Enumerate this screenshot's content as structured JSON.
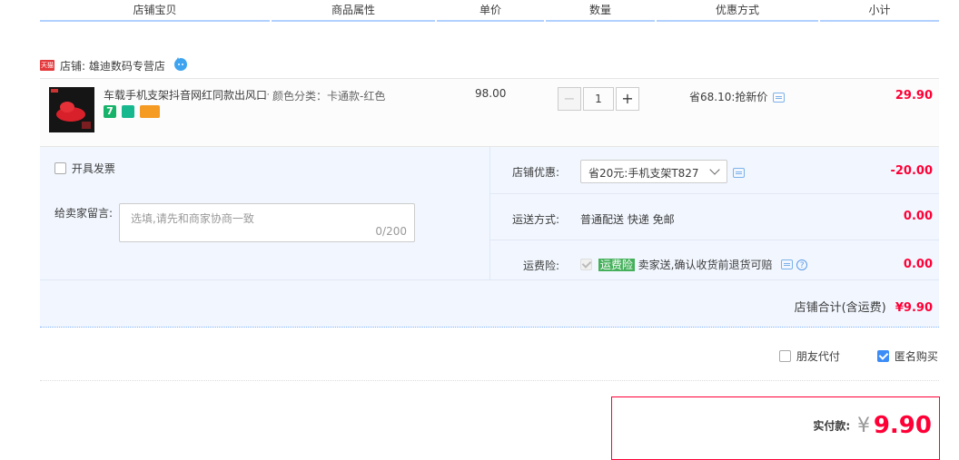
{
  "header": {
    "columns": [
      "店铺宝贝",
      "商品属性",
      "单价",
      "数量",
      "优惠方式",
      "小计"
    ]
  },
  "store": {
    "badge": "天猫",
    "label": "店铺: 雄迪数码专营店"
  },
  "item": {
    "title": "车载手机支架抖音网红同款出风口卡扣式车上支撑架",
    "tag_seven": "7",
    "attribute": "颜色分类：卡通款-红色",
    "unit_price": "98.00",
    "quantity": "1",
    "minus": "−",
    "plus": "+",
    "discount": "省68.10:抢新价",
    "subtotal": "29.90"
  },
  "invoice": {
    "label": "开具发票"
  },
  "message": {
    "label": "给卖家留言:",
    "placeholder": "选填,请先和商家协商一致",
    "counter": "0/200"
  },
  "store_discount": {
    "label": "店铺优惠:",
    "selected": "省20元:手机支架T827",
    "amount": "-20.00"
  },
  "shipping": {
    "label": "运送方式:",
    "value": "普通配送 快递 免邮",
    "amount": "0.00"
  },
  "insurance": {
    "label": "运费险:",
    "tag": "运费险",
    "text": "卖家送,确认收货前退货可赔",
    "help": "?",
    "amount": "0.00"
  },
  "store_total": {
    "label": "店铺合计(含运费)",
    "amount": "¥9.90"
  },
  "options": {
    "friend_pay": "朋友代付",
    "anonymous": "匿名购买"
  },
  "pay": {
    "label": "实付款:",
    "currency": "¥",
    "amount": "9.90"
  },
  "colors": {
    "accent_red": "#ff0036",
    "header_line": "#b2d1ff",
    "panel_bg": "#f2f7ff",
    "check_blue": "#3b8cf6"
  }
}
